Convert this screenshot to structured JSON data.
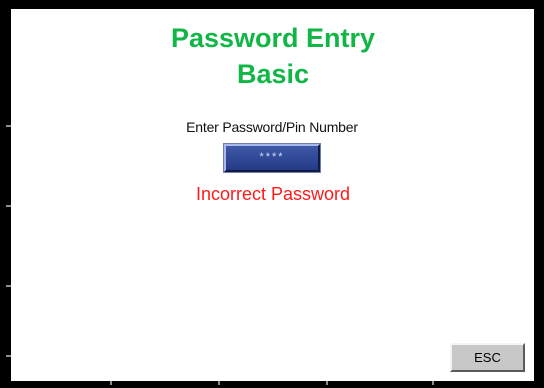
{
  "header": {
    "title_line1": "Password Entry",
    "title_line2": "Basic"
  },
  "form": {
    "prompt_label": "Enter Password/Pin Number",
    "pin_value": "****",
    "error_message": "Incorrect Password"
  },
  "footer": {
    "esc_label": "ESC"
  },
  "colors": {
    "title": "#12b646",
    "error": "#ff1a1a",
    "field_bg": "#2f4798",
    "button_bg": "#c8c8c8",
    "frame": "#000000"
  }
}
